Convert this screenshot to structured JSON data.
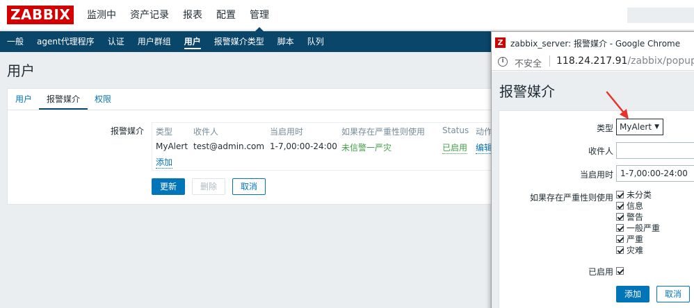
{
  "header": {
    "logo": "ZABBIX",
    "menu": [
      {
        "label": "监测中",
        "active": false
      },
      {
        "label": "资产记录",
        "active": false
      },
      {
        "label": "报表",
        "active": false
      },
      {
        "label": "配置",
        "active": false
      },
      {
        "label": "管理",
        "active": true
      }
    ]
  },
  "subnav": [
    {
      "label": "一般",
      "active": false
    },
    {
      "label": "agent代理程序",
      "active": false
    },
    {
      "label": "认证",
      "active": false
    },
    {
      "label": "用户群组",
      "active": false
    },
    {
      "label": "用户",
      "active": true
    },
    {
      "label": "报警媒介类型",
      "active": false
    },
    {
      "label": "脚本",
      "active": false
    },
    {
      "label": "队列",
      "active": false
    }
  ],
  "page": {
    "title": "用户",
    "tabs": [
      "用户",
      "报警媒介",
      "权限"
    ],
    "active_tab": "报警媒介",
    "media_label": "报警媒介",
    "media_columns": [
      "类型",
      "收件人",
      "当启用时",
      "如果存在严重性则使用",
      "Status",
      "动作"
    ],
    "media_row": {
      "type": "MyAlert",
      "sendto": "test@admin.com",
      "when_active": "1-7,00:00-24:00",
      "severity": "未信警一严灾",
      "status": "已启用",
      "action": "编辑"
    },
    "add_link": "添加",
    "buttons": {
      "update": "更新",
      "delete": "删除",
      "cancel": "取消"
    }
  },
  "popup": {
    "window_title": "zabbix_server: 报警媒介 - Google Chrome",
    "insecure_label": "不安全",
    "url_host": "118.24.217.91",
    "url_path": "/zabbix/popup_",
    "heading": "报警媒介",
    "labels": {
      "type": "类型",
      "sendto": "收件人",
      "when_active": "当启用时",
      "severity": "如果存在严重性则使用",
      "enabled": "已启用"
    },
    "type_value": "MyAlert",
    "sendto_value": "",
    "when_active_value": "1-7,00:00-24:00",
    "severities": [
      "未分类",
      "信息",
      "警告",
      "一般严重",
      "严重",
      "灾难"
    ],
    "buttons": {
      "add": "添加",
      "cancel": "取消"
    }
  },
  "colors": {
    "brand_red": "#d40000",
    "nav_blue": "#0a466a",
    "link_blue": "#0275b8",
    "green": "#429e47",
    "arrow_red": "#e8322b"
  }
}
